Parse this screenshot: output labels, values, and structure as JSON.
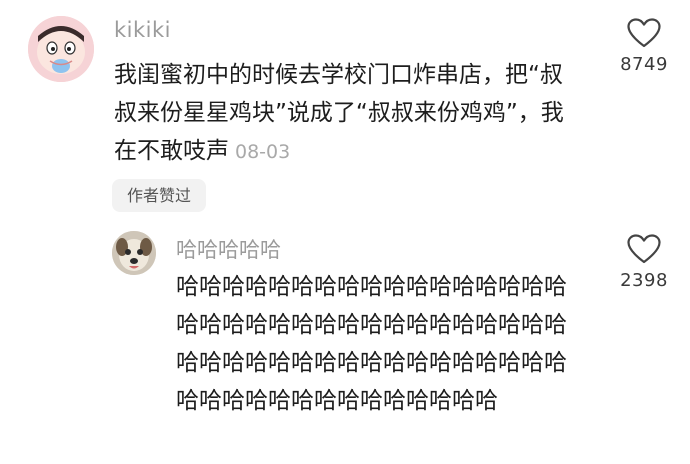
{
  "comment": {
    "username": "kikiki",
    "text": "我闺蜜初中的时候去学校门口炸串店，把“叔叔来份星星鸡块”说成了“叔叔来份鸡鸡”，我在不敢吱声",
    "date": "08-03",
    "author_liked_label": "作者赞过",
    "like_count": "8749",
    "like_icon": "heart-outline-icon",
    "avatar": "cartoon-avatar"
  },
  "reply": {
    "username": "哈哈哈哈哈",
    "text": "哈哈哈哈哈哈哈哈哈哈哈哈哈哈哈哈哈哈哈哈哈哈哈哈哈哈哈哈哈哈哈哈哈哈哈哈哈哈哈哈哈哈哈哈哈哈哈哈哈哈哈哈哈哈哈哈哈哈哈哈哈哈哈哈哈",
    "like_count": "2398",
    "like_icon": "heart-outline-icon",
    "avatar": "dog-avatar"
  }
}
